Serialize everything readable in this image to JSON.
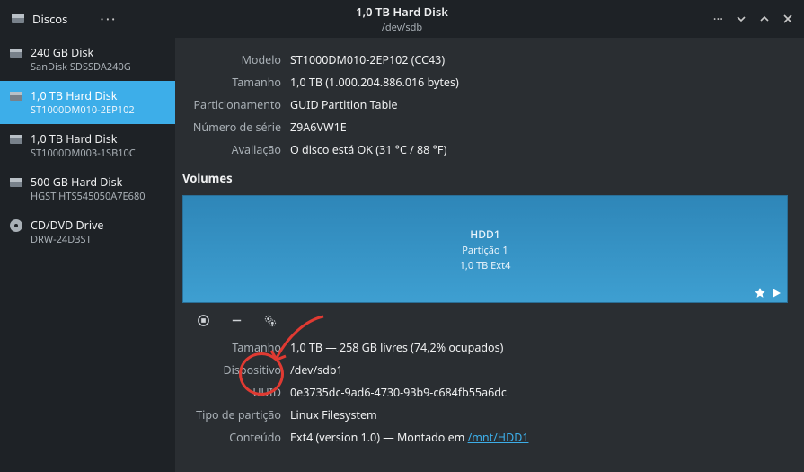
{
  "app": {
    "name": "Discos"
  },
  "header": {
    "title": "1,0 TB Hard Disk",
    "subtitle": "/dev/sdb"
  },
  "sidebar": {
    "items": [
      {
        "title": "240 GB Disk",
        "sub": "SanDisk SDSSDA240G",
        "selected": false,
        "kind": "disk"
      },
      {
        "title": "1,0 TB Hard Disk",
        "sub": "ST1000DM010-2EP102",
        "selected": true,
        "kind": "disk"
      },
      {
        "title": "1,0 TB Hard Disk",
        "sub": "ST1000DM003-1SB10C",
        "selected": false,
        "kind": "disk"
      },
      {
        "title": "500 GB Hard Disk",
        "sub": "HGST HTS545050A7E680",
        "selected": false,
        "kind": "disk"
      },
      {
        "title": "CD/DVD Drive",
        "sub": "DRW-24D3ST",
        "selected": false,
        "kind": "optical"
      }
    ]
  },
  "disk": {
    "labels": {
      "modelo": "Modelo",
      "tamanho": "Tamanho",
      "particionamento": "Particionamento",
      "serie": "Número de série",
      "avaliacao": "Avaliação"
    },
    "modelo": "ST1000DM010-2EP102 (CC43)",
    "tamanho": "1,0 TB (1.000.204.886.016 bytes)",
    "particionamento": "GUID Partition Table",
    "serie": "Z9A6VW1E",
    "avaliacao": "O disco está OK (31 °C / 88 °F)"
  },
  "volumes": {
    "heading": "Volumes",
    "partition": {
      "name": "HDD1",
      "sub1": "Partição 1",
      "sub2": "1,0 TB Ext4"
    },
    "labels": {
      "tamanho": "Tamanho",
      "dispositivo": "Dispositivo",
      "uuid": "UUID",
      "tipo": "Tipo de partição",
      "conteudo": "Conteúdo"
    },
    "tamanho": "1,0 TB — 258 GB livres (74,2% ocupados)",
    "dispositivo": "/dev/sdb1",
    "uuid": "0e3735dc-9ad6-4730-93b9-c684fb55a6dc",
    "tipo": "Linux Filesystem",
    "conteudo_pre": "Ext4 (version 1.0) — Montado em ",
    "conteudo_link": "/mnt/HDD1"
  }
}
